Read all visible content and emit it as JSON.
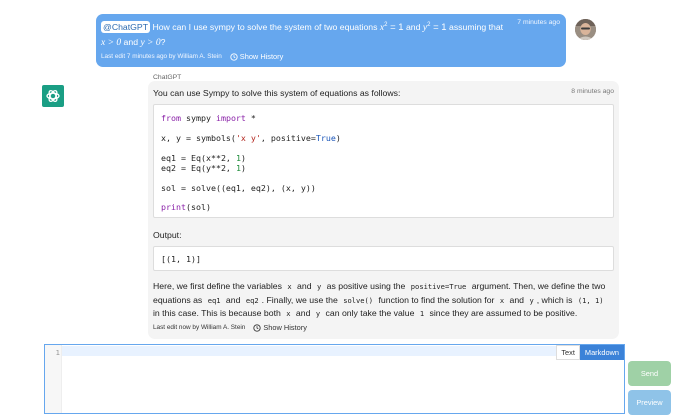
{
  "user_message": {
    "mention": "@ChatGPT",
    "text_before": " How can I use sympy to solve the system of two equations ",
    "eq1_base": "x",
    "eq1_exp": "2",
    "eq1_rest": " = 1",
    "connector": " and ",
    "eq2_base": "y",
    "eq2_exp": "2",
    "eq2_rest": " = 1",
    "text_after": " assuming that",
    "cond1": "x > 0",
    "and_word": " and ",
    "cond2": "y > 0",
    "question_mark": "?",
    "time": "7 minutes ago",
    "edit_info": "Last edit 7 minutes ago by William A. Stein",
    "history_label": "Show History"
  },
  "assistant": {
    "name": "ChatGPT",
    "time": "8 minutes ago",
    "intro": "You can use Sympy to solve this system of equations as follows:",
    "output_label": "Output:",
    "output": "[(1, 1)]",
    "explain": {
      "p1": "Here, we first define the variables ",
      "c1": "x",
      "p2": " and ",
      "c2": "y",
      "p3": " as positive using the ",
      "c3": "positive=True",
      "p4": " argument. Then, we define the two equations as ",
      "c4": "eq1",
      "p5": " and ",
      "c5": "eq2",
      "p6": ". Finally, we use the ",
      "c6": "solve()",
      "p7": " function to find the solution for ",
      "c7": "x",
      "p8": " and ",
      "c8": "y",
      "p9": ", which is ",
      "c9": "(1, 1)",
      "p10": " in this case. This is because both ",
      "c10": "x",
      "p11": " and ",
      "c11": "y",
      "p12": " can only take the value ",
      "c12": "1",
      "p13": " since they are assumed to be positive."
    },
    "edit_info": "Last edit now by William A. Stein",
    "history_label": "Show History"
  },
  "code": {
    "l1_kw1": "from",
    "l1_mod": " sympy ",
    "l1_kw2": "import",
    "l1_rest": " *",
    "l2_a": "x, y = symbols(",
    "l2_str": "'x y'",
    "l2_b": ", positive=",
    "l2_bool": "True",
    "l2_c": ")",
    "l3_a": "eq1 = Eq(x**2, ",
    "l3_num": "1",
    "l3_b": ")",
    "l4_a": "eq2 = Eq(y**2, ",
    "l4_num": "1",
    "l4_b": ")",
    "l5": "sol = solve((eq1, eq2), (x, y))",
    "l6_kw": "print",
    "l6_rest": "(sol)"
  },
  "editor": {
    "line_number": "1",
    "mode_text": "Text",
    "mode_markdown": "Markdown",
    "active_mode": "Markdown"
  },
  "buttons": {
    "send": "Send",
    "preview": "Preview"
  },
  "icons": {
    "history": "history-icon",
    "bot": "openai-logo-icon"
  },
  "colors": {
    "user_bubble": "#66a7ee",
    "bot_bubble": "#f4f4f4",
    "send": "#9fd1a6",
    "preview": "#8fc3e8",
    "markdown_active": "#3b82d8"
  }
}
